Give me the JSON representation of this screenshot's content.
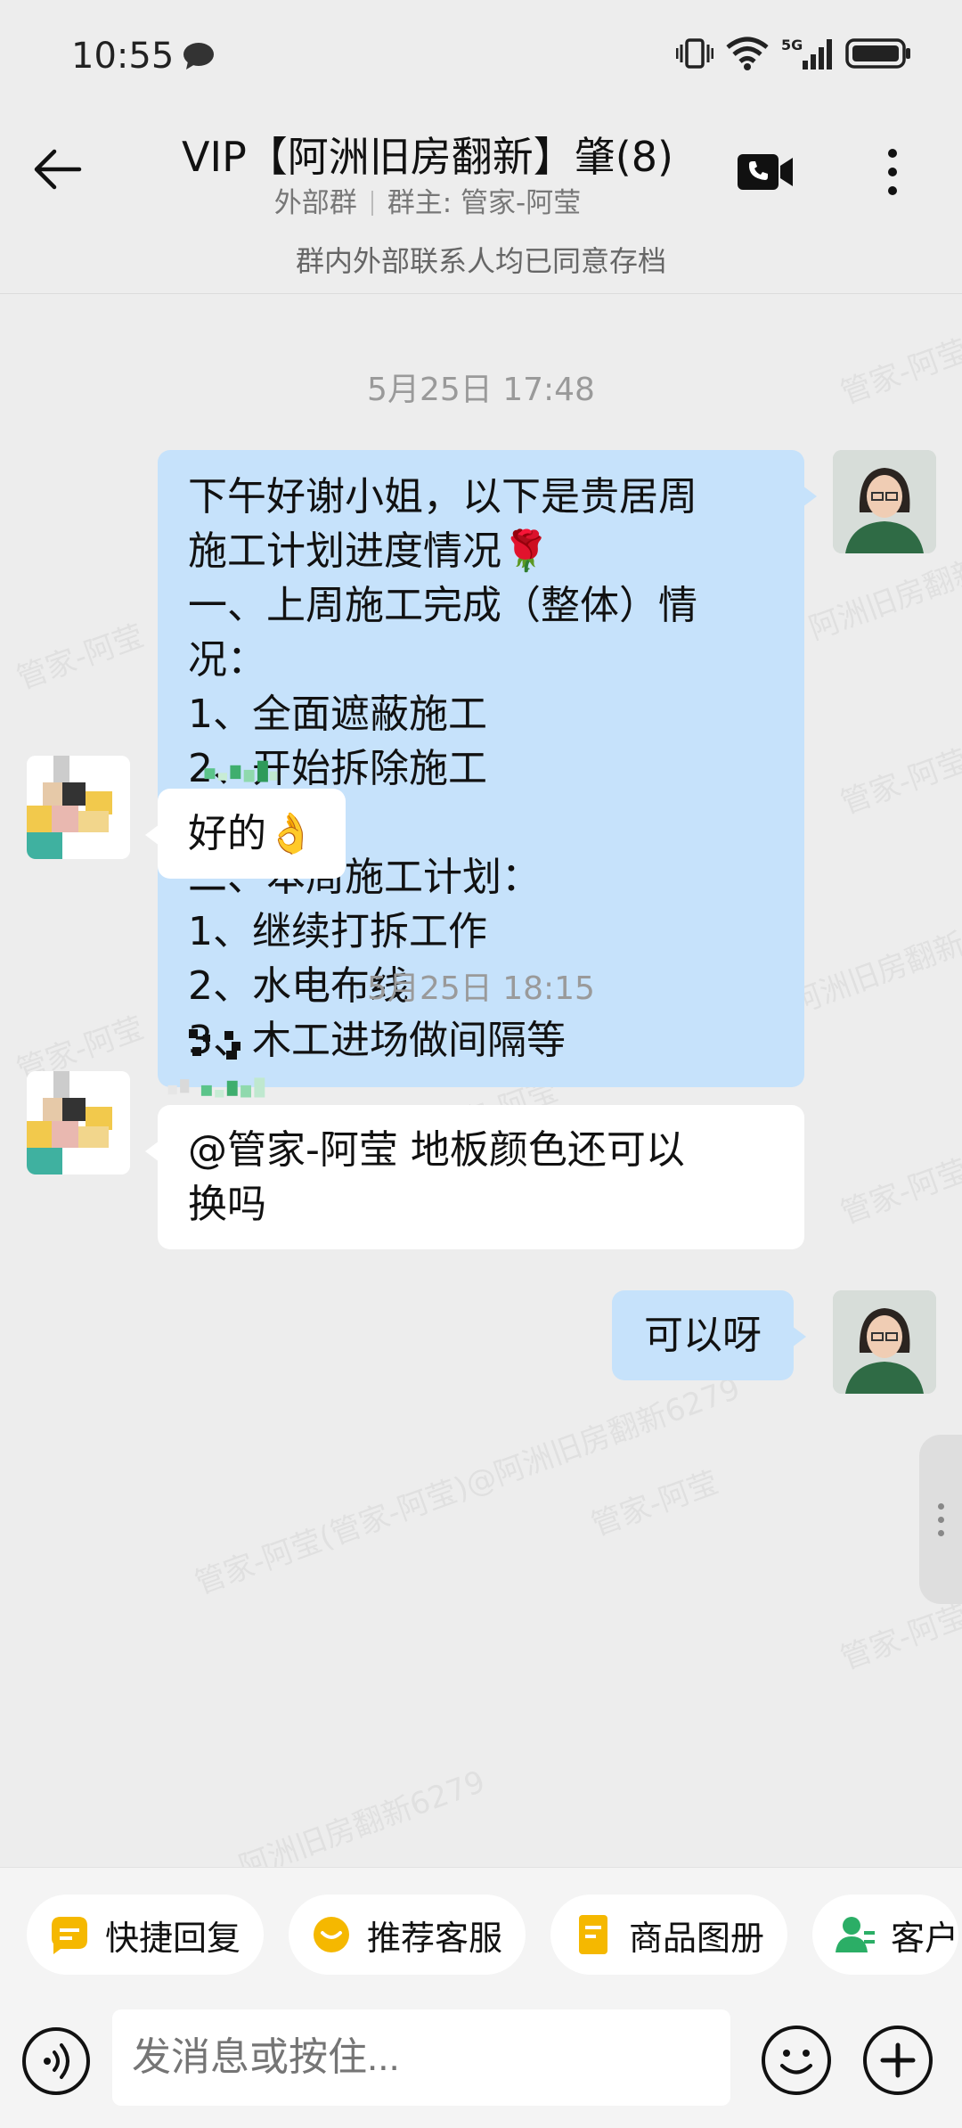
{
  "status_bar": {
    "time": "10:55",
    "icons": [
      "chat-notification-icon",
      "vibrate-icon",
      "wifi-icon",
      "5g-signal-icon",
      "battery-icon"
    ],
    "network": "5G"
  },
  "header": {
    "title": "VIP【阿洲旧房翻新】肇(8)",
    "group_type": "外部群",
    "group_owner": "群主: 管家-阿莹",
    "archive_notice": "群内外部联系人均已同意存档"
  },
  "chat": {
    "watermark": "管家-阿莹(管家-阿莹)@阿洲旧房翻新6279",
    "watermark_short": "管家-阿莹",
    "watermark_mid": "阿洲旧房翻新6279",
    "time_separators": [
      "5月25日  17:48",
      "5月25日  18:15"
    ],
    "messages": [
      {
        "direction": "out",
        "text": "下午好谢小姐，以下是贵居周\n施工计划进度情况🌹\n一、上周施工完成（整体）情况：\n1、全面遮蔽施工\n2、开始拆除施工\n\n二、本周施工计划：\n1、继续打拆工作\n2、水电布线\n3、木工进场做间隔等\n"
      },
      {
        "direction": "in",
        "text": "好的👌"
      },
      {
        "direction": "in",
        "text": "@管家-阿莹 地板颜色还可以\n换吗"
      },
      {
        "direction": "out",
        "text": "可以呀"
      }
    ]
  },
  "quick_bar": {
    "chips": [
      {
        "label": "快捷回复",
        "icon": "quick-reply-icon"
      },
      {
        "label": "推荐客服",
        "icon": "recommend-service-icon"
      },
      {
        "label": "商品图册",
        "icon": "product-album-icon"
      },
      {
        "label": "客户",
        "icon": "customer-icon"
      }
    ]
  },
  "input_bar": {
    "placeholder": "发消息或按住..."
  },
  "colors": {
    "background": "#ededed",
    "bubble_out": "#c6e2fb",
    "bubble_in": "#ffffff",
    "chip_icon_yellow": "#f5b800",
    "chip_icon_green": "#2bae66"
  }
}
